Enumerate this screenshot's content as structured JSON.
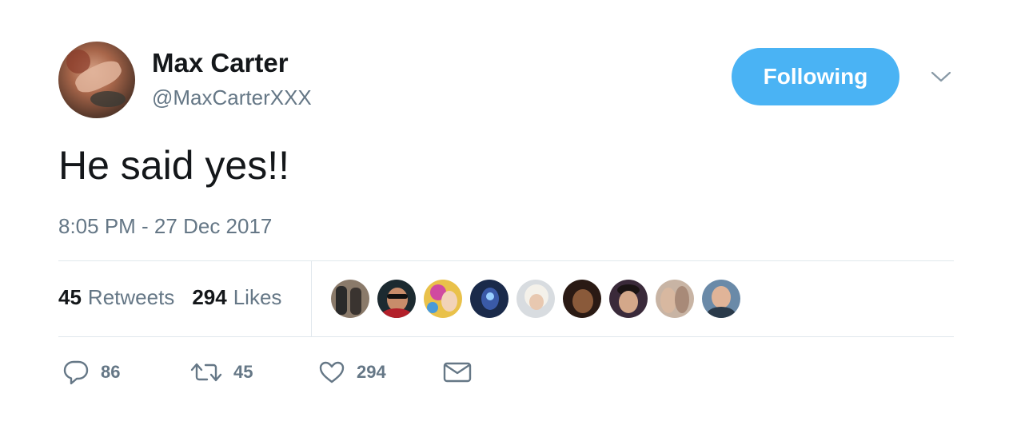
{
  "author": {
    "name": "Max Carter",
    "handle": "@MaxCarterXXX"
  },
  "follow_button": {
    "label": "Following"
  },
  "tweet": {
    "text": "He said yes!!",
    "timestamp": "8:05 PM - 27 Dec 2017"
  },
  "stats": {
    "retweets_count": "45",
    "retweets_label": "Retweets",
    "likes_count": "294",
    "likes_label": "Likes"
  },
  "actions": {
    "replies": "86",
    "retweets": "45",
    "likes": "294"
  },
  "icons": {
    "reply": "reply-icon",
    "retweet": "retweet-icon",
    "like": "heart-icon",
    "message": "envelope-icon",
    "menu": "chevron-down-icon"
  },
  "colors": {
    "accent": "#4ab3f4",
    "secondary_text": "#657786",
    "primary_text": "#14171a",
    "divider": "#e1e8ed"
  }
}
